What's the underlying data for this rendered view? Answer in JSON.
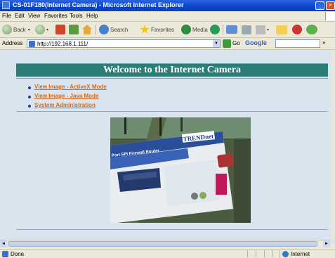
{
  "window": {
    "title": "CS-01F180(Internet Camera) - Microsoft Internet Explorer"
  },
  "menu": [
    "File",
    "Edit",
    "View",
    "Favorites",
    "Tools",
    "Help"
  ],
  "toolbar": {
    "back": "Back",
    "search": "Search",
    "favorites": "Favorites",
    "media": "Media"
  },
  "address": {
    "label": "Address",
    "url": "http://192.168.1.111/",
    "go": "Go",
    "google": "Google",
    "more": "»"
  },
  "page": {
    "heading": "Welcome to the Internet Camera",
    "links": [
      "View Image - ActiveX Mode",
      "View Image - Java Mode",
      "System Administration"
    ],
    "camera_brand": "TRENDnet",
    "camera_box_label": "Port SPI Firewall Router"
  },
  "status": {
    "text": "Done",
    "zone": "Internet"
  },
  "colors": {
    "banner": "#2a7d78",
    "link": "#d46a1a",
    "page_bg": "#d9e4ee",
    "titlebar": "#0a45c9"
  }
}
